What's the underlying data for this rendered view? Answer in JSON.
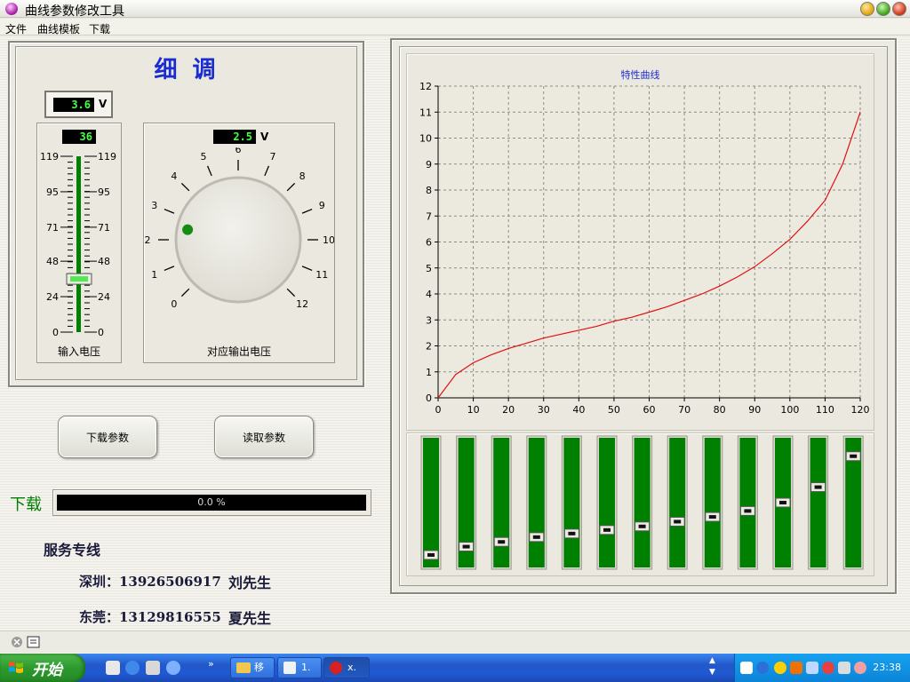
{
  "window": {
    "title": "曲线参数修改工具"
  },
  "menu": [
    "文件",
    "曲线模板",
    "下载"
  ],
  "fine_tune": {
    "title": "细 调",
    "voltage_display": "3.6",
    "voltage_unit": "V",
    "slider_display": "36",
    "slider_value": 36,
    "slider_max": 119,
    "slider_ticks": [
      "119",
      "95",
      "71",
      "48",
      "24",
      "0"
    ],
    "slider_label": "输入电压",
    "knob_display": "2.5",
    "knob_unit": "V",
    "knob_value": 2.5,
    "knob_labels": [
      "0",
      "1",
      "2",
      "3",
      "4",
      "5",
      "6",
      "7",
      "8",
      "9",
      "10",
      "11",
      "12"
    ],
    "knob_label": "对应输出电压"
  },
  "buttons": {
    "download": "下载参数",
    "read": "读取参数"
  },
  "download": {
    "label": "下载",
    "progress_text": "0.0 %",
    "progress": 0.0
  },
  "service": {
    "title": "服务专线",
    "shenzhen": "深圳：13926506917",
    "shenzhen_contact": "刘先生",
    "dongguan": "东莞：13129816555",
    "dongguan_contact": "夏先生"
  },
  "chart_data": {
    "type": "line",
    "title": "特性曲线",
    "xlabel": "",
    "ylabel": "",
    "xlim": [
      0,
      120
    ],
    "ylim": [
      0,
      12
    ],
    "grid": true,
    "color": "#e01010",
    "x": [
      0,
      5,
      10,
      15,
      20,
      25,
      30,
      35,
      40,
      45,
      50,
      55,
      60,
      65,
      70,
      75,
      80,
      85,
      90,
      95,
      100,
      105,
      110,
      115,
      120
    ],
    "y": [
      0,
      0.9,
      1.35,
      1.65,
      1.9,
      2.1,
      2.3,
      2.45,
      2.6,
      2.75,
      2.95,
      3.1,
      3.3,
      3.5,
      3.75,
      4.0,
      4.3,
      4.65,
      5.05,
      5.55,
      6.1,
      6.8,
      7.6,
      9.0,
      11.0
    ],
    "xticks": [
      "0",
      "10",
      "20",
      "30",
      "40",
      "50",
      "60",
      "70",
      "80",
      "90",
      "100",
      "110",
      "120"
    ],
    "yticks": [
      "0",
      "1",
      "2",
      "3",
      "4",
      "5",
      "6",
      "7",
      "8",
      "9",
      "10",
      "11",
      "12"
    ]
  },
  "sliders": [
    0.06,
    0.13,
    0.17,
    0.21,
    0.24,
    0.27,
    0.3,
    0.34,
    0.38,
    0.43,
    0.5,
    0.63,
    0.89
  ],
  "colors": {
    "accent_green": "#008000",
    "lcd_text": "#46ff46",
    "curve": "#e01010",
    "title_blue": "#1b2cd0"
  },
  "taskbar": {
    "start": "开始",
    "tasks": [
      "移",
      "1.",
      "x."
    ],
    "clock": "23:38"
  }
}
